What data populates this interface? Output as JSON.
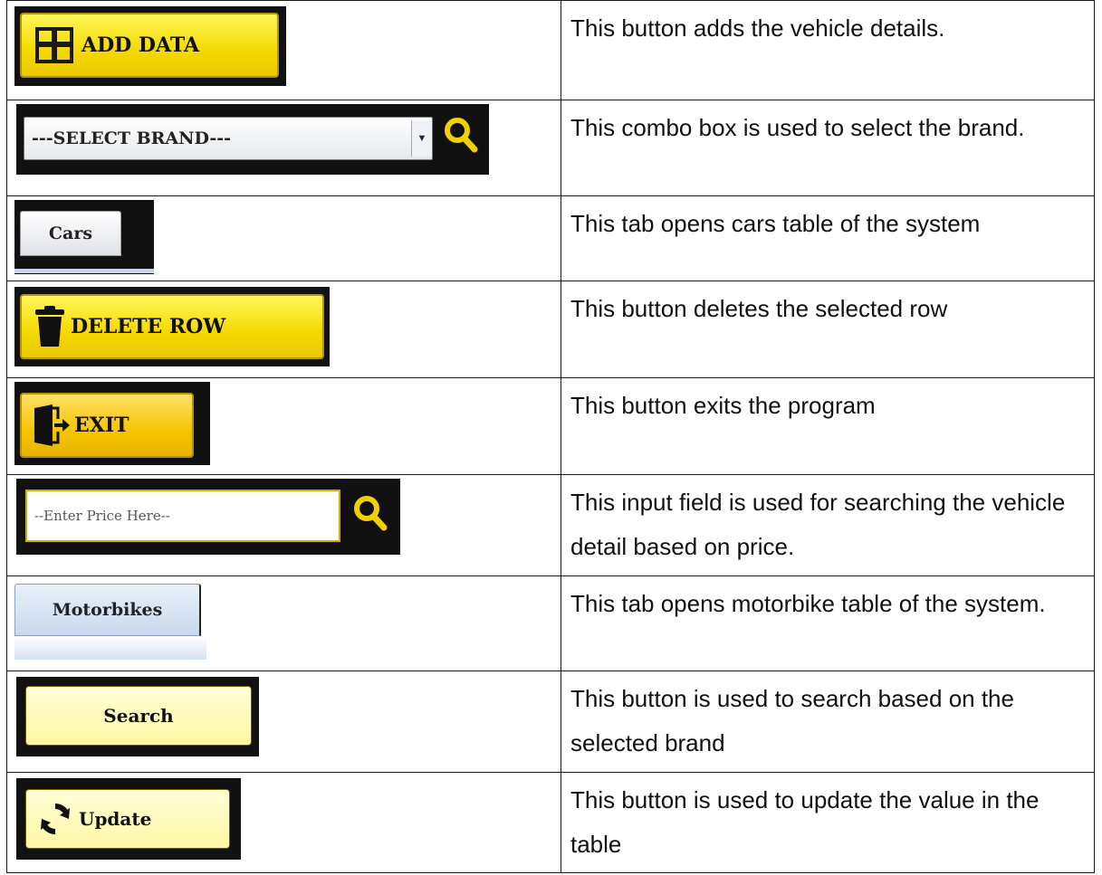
{
  "rows": [
    {
      "label": "ADD DATA",
      "icon": "plus-box-icon",
      "description": "This button adds the vehicle details."
    },
    {
      "label": "---SELECT BRAND---",
      "icon": "search-icon",
      "description": "This combo box is used to select the brand."
    },
    {
      "label": "Cars",
      "description": "This tab opens cars table of the system"
    },
    {
      "label": "DELETE ROW",
      "icon": "trash-icon",
      "description": "This button deletes the selected row"
    },
    {
      "label": "EXIT",
      "icon": "exit-door-icon",
      "description": "This button exits the program"
    },
    {
      "label": "--Enter Price Here--",
      "icon": "search-icon",
      "description": "This input field is used for searching the vehicle detail based on price."
    },
    {
      "label": "Motorbikes",
      "description": "This tab opens motorbike table of the system."
    },
    {
      "label": "Search",
      "description": "This button is used to search based on the selected brand"
    },
    {
      "label": "Update",
      "icon": "refresh-icon",
      "description": "This button  is used to update the value in the table"
    }
  ],
  "colors": {
    "button_yellow": "#f4d900",
    "button_light_yellow": "#fff7a4",
    "search_icon": "#f2d000",
    "dark_background": "#111111"
  }
}
